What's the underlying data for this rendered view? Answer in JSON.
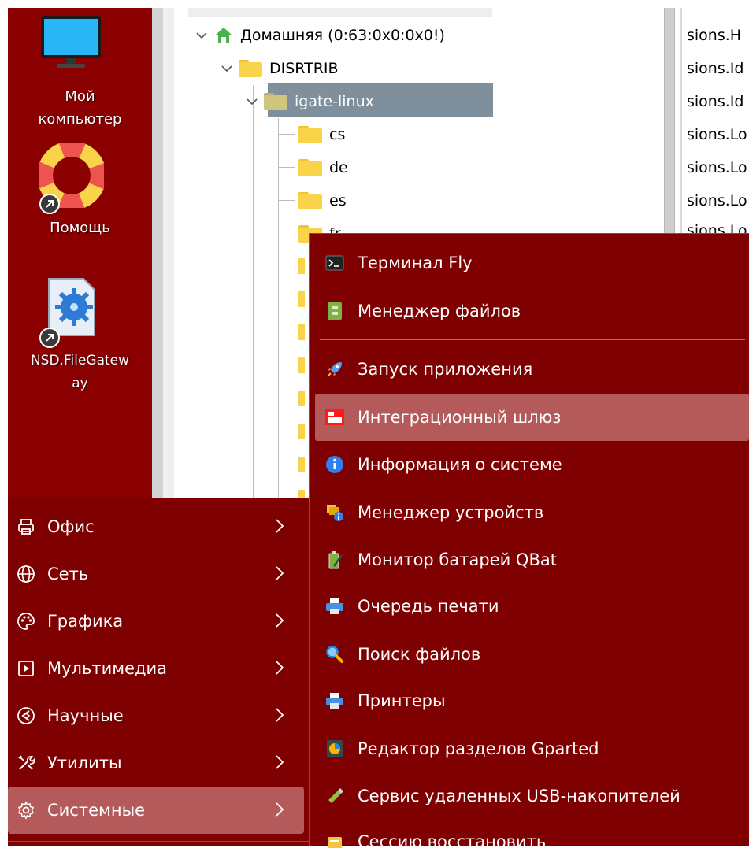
{
  "desktop": {
    "icons": [
      {
        "label_line1": "Мой",
        "label_line2": "компьютер",
        "icon": "monitor-icon"
      },
      {
        "label_line1": "Помощь",
        "icon": "lifebuoy-icon"
      },
      {
        "label_line1": "NSD.FileGatew",
        "label_line2": "ay",
        "icon": "gear-file-icon"
      }
    ]
  },
  "file_manager": {
    "tree": {
      "home": "Домашняя (0:63:0x0:0x0!)",
      "disrtrib": "DISRTRIB",
      "selected": "igate-linux",
      "children": [
        "cs",
        "de",
        "es",
        "fr"
      ]
    },
    "right_column": [
      "sions.H",
      "sions.Id",
      "sions.Id",
      "sions.Lo",
      "sions.Lo",
      "sions.Lo",
      "sions.Lo"
    ]
  },
  "start_menu": {
    "categories": [
      {
        "label": "Офис",
        "icon": "printer-outline-icon"
      },
      {
        "label": "Сеть",
        "icon": "globe-icon"
      },
      {
        "label": "Графика",
        "icon": "palette-icon"
      },
      {
        "label": "Мультимедиа",
        "icon": "play-box-icon"
      },
      {
        "label": "Научные",
        "icon": "science-icon"
      },
      {
        "label": "Утилиты",
        "icon": "tools-icon"
      },
      {
        "label": "Системные",
        "icon": "gear-icon",
        "selected": true
      }
    ]
  },
  "submenu": {
    "items": [
      {
        "label": "Терминал Fly",
        "icon": "terminal-icon"
      },
      {
        "label": "Менеджер файлов",
        "icon": "file-manager-icon"
      },
      {
        "label": "Запуск приложения",
        "icon": "rocket-icon"
      },
      {
        "label": "Интеграционный шлюз",
        "icon": "gateway-icon",
        "selected": true
      },
      {
        "label": "Информация о системе",
        "icon": "info-icon"
      },
      {
        "label": "Менеджер устройств",
        "icon": "device-manager-icon"
      },
      {
        "label": "Монитор батарей QBat",
        "icon": "battery-icon"
      },
      {
        "label": "Очередь печати",
        "icon": "print-queue-icon"
      },
      {
        "label": "Поиск файлов",
        "icon": "magnifier-icon"
      },
      {
        "label": "Принтеры",
        "icon": "printer-icon"
      },
      {
        "label": "Редактор разделов Gparted",
        "icon": "gparted-icon"
      },
      {
        "label": "Сервис удаленных USB-накопителей",
        "icon": "usb-icon"
      },
      {
        "label": "Сессию восстановить",
        "icon": "session-icon"
      }
    ]
  }
}
